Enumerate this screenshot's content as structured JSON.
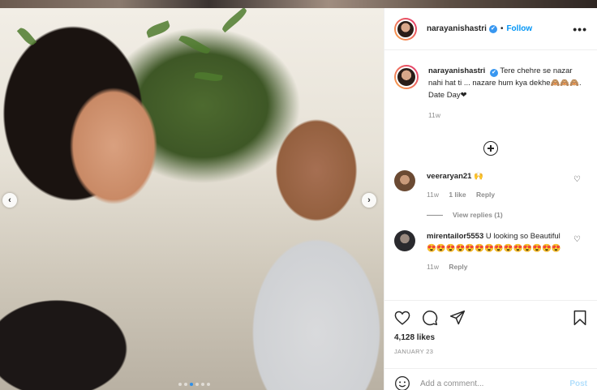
{
  "post": {
    "username": "narayanishastri",
    "follow_label": "Follow",
    "dot": "•",
    "verified_mark": "✔",
    "more_label": "•••",
    "caption_text": "Tere chehre se nazar nahi hat ti ... nazare hum kya dekhe🙈🙈🙈. Date Day❤",
    "caption_time": "11w",
    "likes": "4,128 likes",
    "date": "JANUARY 23"
  },
  "comments": [
    {
      "username": "veeraryan21",
      "text": "🙌",
      "time": "11w",
      "likes": "1 like",
      "reply": "Reply",
      "view_replies": "View replies (1)"
    },
    {
      "username": "mirentailor5553",
      "text": "U looking so Beautiful 😍😍😍😍😍😍😍😍😍😍😍😍😍😍",
      "time": "11w",
      "reply": "Reply"
    }
  ],
  "add_comment": {
    "placeholder": "Add a comment...",
    "post_label": "Post"
  },
  "carousel": {
    "prev": "‹",
    "next": "›",
    "total": 6,
    "active_index": 2
  },
  "colors": {
    "link_blue": "#0095f6",
    "verified_blue": "#3897f0",
    "muted": "#8e8e8e"
  }
}
